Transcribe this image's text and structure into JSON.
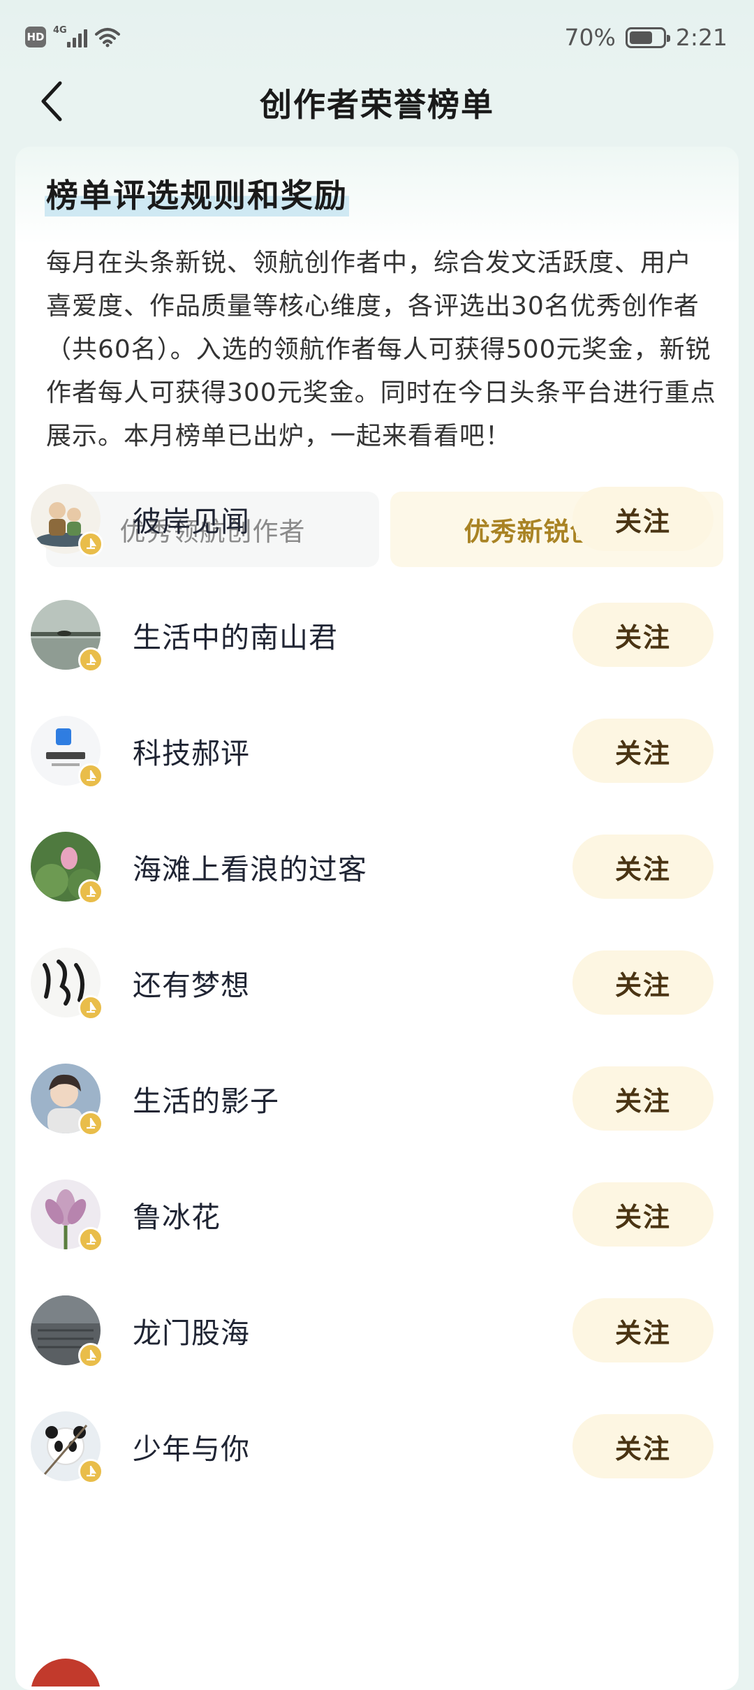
{
  "status_bar": {
    "hd": "HD",
    "network": "4G",
    "battery": "70%",
    "battery_level": 0.7,
    "time": "2:21"
  },
  "nav": {
    "title": "创作者荣誉榜单"
  },
  "rules": {
    "title": "榜单评选规则和奖励",
    "description": "每月在头条新锐、领航创作者中，综合发文活跃度、用户喜爱度、作品质量等核心维度，各评选出30名优秀创作者（共60名）。入选的领航作者每人可获得500元奖金，新锐作者每人可获得300元奖金。同时在今日头条平台进行重点展示。本月榜单已出炉，一起来看看吧！"
  },
  "tabs": [
    {
      "label": "优秀领航创作者",
      "active": false
    },
    {
      "label": "优秀新锐创作者",
      "active": true
    }
  ],
  "creators": [
    {
      "name": "彼岸见闻",
      "follow_label": "关注",
      "avatar_icon": "cartoon-people-avatar"
    },
    {
      "name": "生活中的南山君",
      "follow_label": "关注",
      "avatar_icon": "lake-scene-avatar"
    },
    {
      "name": "科技郝评",
      "follow_label": "关注",
      "avatar_icon": "tech-logo-avatar"
    },
    {
      "name": "海滩上看浪的过客",
      "follow_label": "关注",
      "avatar_icon": "lotus-avatar"
    },
    {
      "name": "还有梦想",
      "follow_label": "关注",
      "avatar_icon": "calligraphy-avatar"
    },
    {
      "name": "生活的影子",
      "follow_label": "关注",
      "avatar_icon": "anime-boy-avatar"
    },
    {
      "name": "鲁冰花",
      "follow_label": "关注",
      "avatar_icon": "flower-avatar"
    },
    {
      "name": "龙门股海",
      "follow_label": "关注",
      "avatar_icon": "stone-wall-avatar"
    },
    {
      "name": "少年与你",
      "follow_label": "关注",
      "avatar_icon": "panda-avatar"
    }
  ],
  "colors": {
    "accent_gold": "#a98324",
    "follow_bg": "#fdf6e2",
    "badge_gold": "#e9bd4a",
    "page_bg": "#e9f3f1"
  }
}
